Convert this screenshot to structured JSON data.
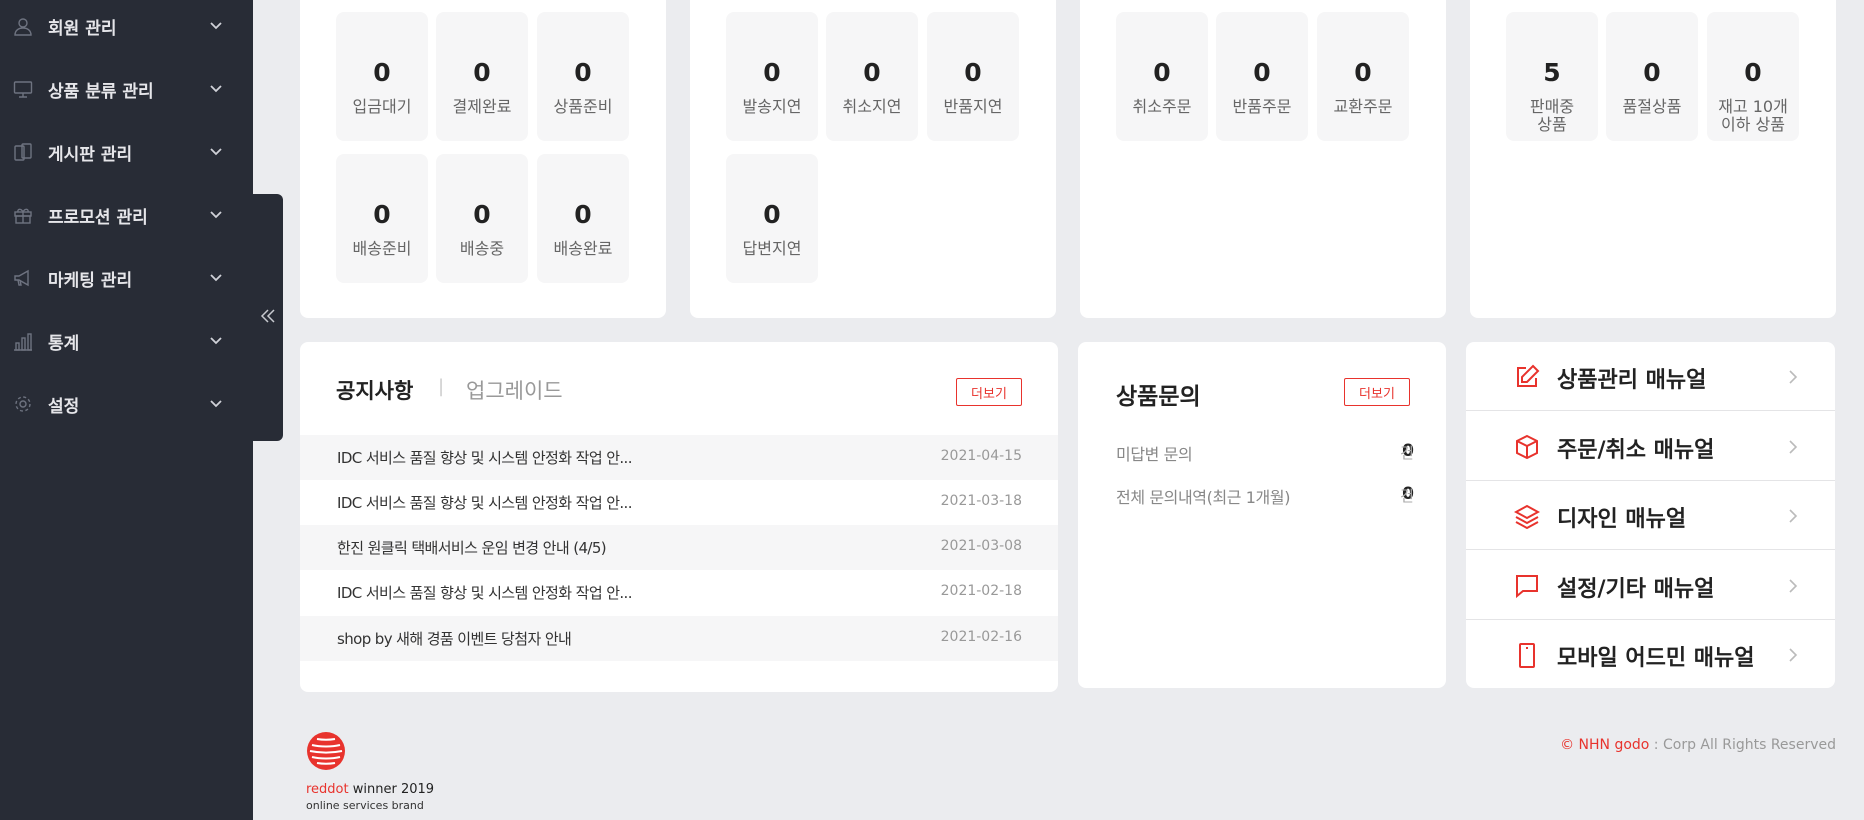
{
  "sidebar": {
    "items": [
      {
        "label": "회원 관리",
        "icon": "user-icon"
      },
      {
        "label": "상품 분류 관리",
        "icon": "monitor-icon"
      },
      {
        "label": "게시판 관리",
        "icon": "board-icon"
      },
      {
        "label": "프로모션 관리",
        "icon": "gift-icon"
      },
      {
        "label": "마케팅 관리",
        "icon": "megaphone-icon"
      },
      {
        "label": "통계",
        "icon": "bar-chart-icon"
      },
      {
        "label": "설정",
        "icon": "gear-icon"
      }
    ]
  },
  "order_status": {
    "stats": [
      {
        "value": "0",
        "label": "입금대기"
      },
      {
        "value": "0",
        "label": "결제완료"
      },
      {
        "value": "0",
        "label": "상품준비"
      },
      {
        "value": "0",
        "label": "배송준비"
      },
      {
        "value": "0",
        "label": "배송중"
      },
      {
        "value": "0",
        "label": "배송완료"
      }
    ]
  },
  "delay_status": {
    "stats": [
      {
        "value": "0",
        "label": "발송지연"
      },
      {
        "value": "0",
        "label": "취소지연"
      },
      {
        "value": "0",
        "label": "반품지연"
      },
      {
        "value": "0",
        "label": "답변지연"
      }
    ]
  },
  "claim_status": {
    "stats": [
      {
        "value": "0",
        "label": "취소주문"
      },
      {
        "value": "0",
        "label": "반품주문"
      },
      {
        "value": "0",
        "label": "교환주문"
      }
    ]
  },
  "product_status": {
    "stats": [
      {
        "value": "5",
        "label1": "판매중",
        "label2": "상품"
      },
      {
        "value": "0",
        "label1": "품절상품",
        "label2": ""
      },
      {
        "value": "0",
        "label1": "재고 10개",
        "label2": "이하 상품"
      }
    ]
  },
  "notice": {
    "tab_active": "공지사항",
    "tab_separator": "|",
    "tab_inactive": "업그레이드",
    "more_label": "더보기",
    "rows": [
      {
        "title": "IDC 서비스 품질 향상 및 시스템 안정화 작업 안...",
        "date": "2021-04-15"
      },
      {
        "title": "IDC 서비스 품질 향상 및 시스템 안정화 작업 안...",
        "date": "2021-03-18"
      },
      {
        "title": "한진 원클릭 택배서비스 운임 변경 안내 (4/5)",
        "date": "2021-03-08"
      },
      {
        "title": "IDC 서비스 품질 향상 및 시스템 안정화 작업 안...",
        "date": "2021-02-18"
      },
      {
        "title": "shop by 새해 경품 이벤트 당첨자 안내",
        "date": "2021-02-16"
      }
    ]
  },
  "inquiry": {
    "title": "상품문의",
    "more_label": "더보기",
    "rows": [
      {
        "label": "미답변 문의",
        "count": "0",
        "unit": "건"
      },
      {
        "label": "전체 문의내역(최근 1개월)",
        "count": "0",
        "unit": "건"
      }
    ]
  },
  "manuals": {
    "items": [
      {
        "label": "상품관리 매뉴얼",
        "icon": "edit-icon"
      },
      {
        "label": "주문/취소 매뉴얼",
        "icon": "box-icon"
      },
      {
        "label": "디자인 매뉴얼",
        "icon": "layers-icon"
      },
      {
        "label": "설정/기타 매뉴얼",
        "icon": "chat-bubble-icon"
      },
      {
        "label": "모바일 어드민 매뉴얼",
        "icon": "mobile-icon"
      }
    ]
  },
  "footer": {
    "copyright_brand": "© NHN godo",
    "copyright_rest": " : Corp All Rights Reserved",
    "award_red": "reddot",
    "award_rest": " winner 2019",
    "award_sub": "online services brand"
  },
  "colors": {
    "accent": "#e8332d",
    "sidebar_bg": "#282c36",
    "page_bg": "#ebecef"
  }
}
